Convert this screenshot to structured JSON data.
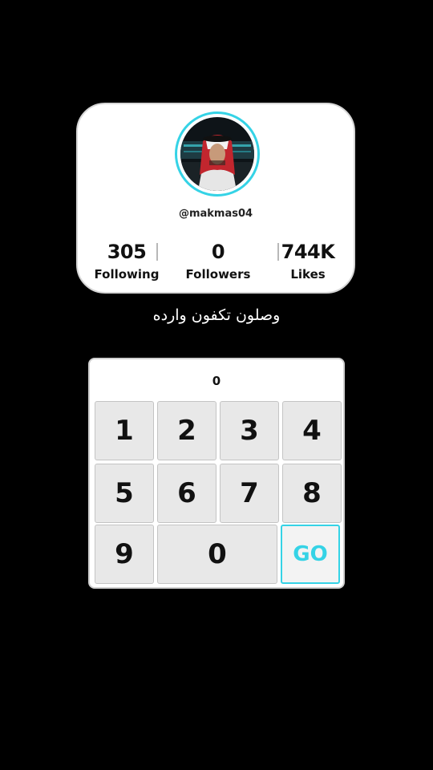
{
  "profile": {
    "username": "@makmas04",
    "stats": [
      {
        "value": "305",
        "label": "Following"
      },
      {
        "value": "0",
        "label": "Followers"
      },
      {
        "value": "744K",
        "label": "Likes"
      }
    ]
  },
  "caption": "وصلون تكفون وارده",
  "keypad": {
    "display": "0",
    "keys": [
      "1",
      "2",
      "3",
      "4",
      "5",
      "6",
      "7",
      "8",
      "9",
      "0"
    ],
    "go_label": "GO"
  },
  "colors": {
    "accent": "#35d3e6",
    "background": "#000000",
    "card": "#ffffff",
    "key": "#e8e8e8"
  }
}
